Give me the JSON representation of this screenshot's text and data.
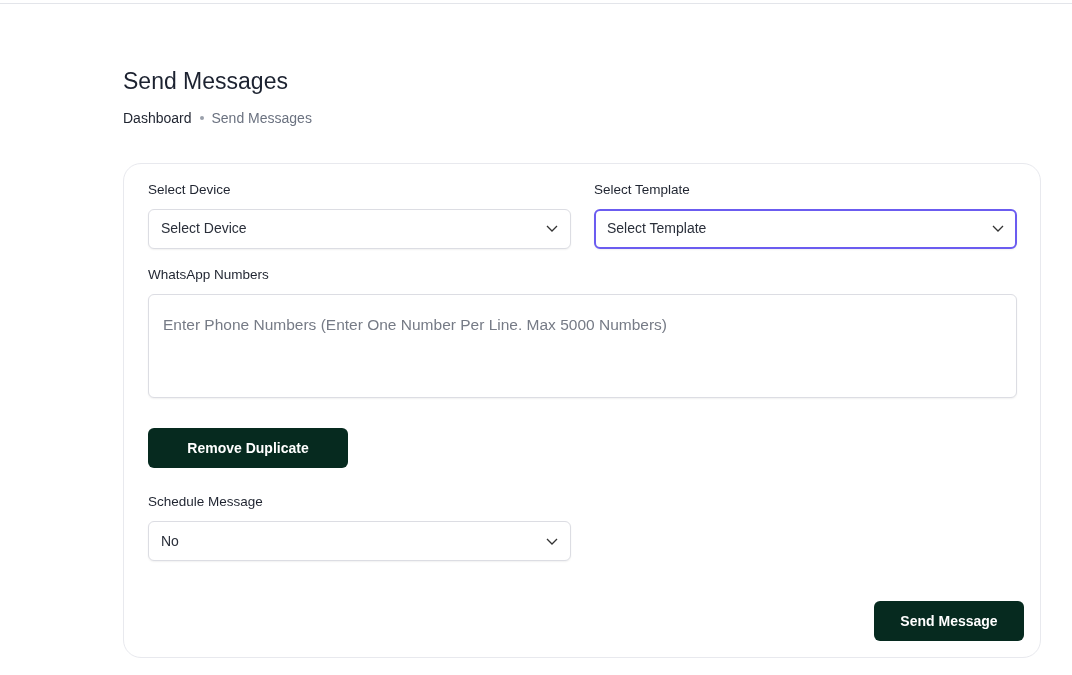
{
  "page": {
    "title": "Send Messages"
  },
  "breadcrumb": [
    {
      "label": "Dashboard",
      "current": false
    },
    {
      "label": "Send Messages",
      "current": true
    }
  ],
  "form": {
    "device": {
      "label": "Select Device",
      "value": "Select Device",
      "focused": false
    },
    "template": {
      "label": "Select Template",
      "value": "Select Template",
      "focused": true
    },
    "numbers": {
      "label": "WhatsApp Numbers",
      "placeholder": "Enter Phone Numbers (Enter One Number Per Line. Max 5000 Numbers)"
    },
    "remove_duplicate_button": "Remove Duplicate",
    "schedule": {
      "label": "Schedule Message",
      "value": "No",
      "focused": false
    },
    "submit_button": "Send Message"
  }
}
